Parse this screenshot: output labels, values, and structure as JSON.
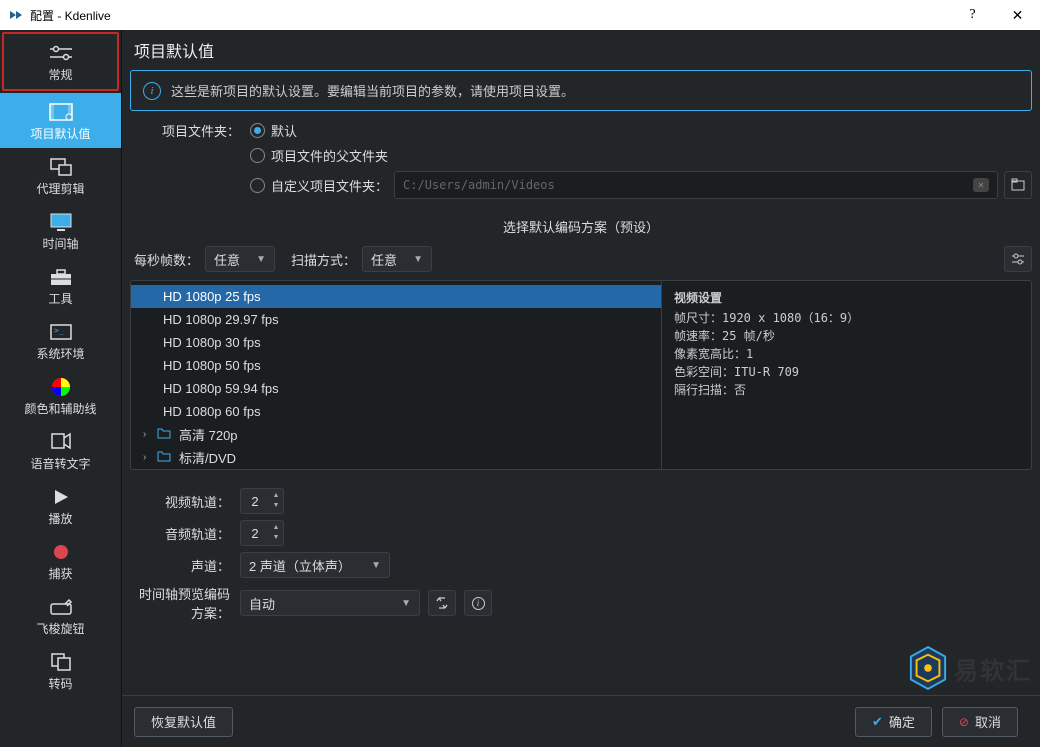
{
  "window": {
    "title": "配置 - Kdenlive"
  },
  "sidebar": {
    "items": [
      {
        "label": "常规"
      },
      {
        "label": "项目默认值"
      },
      {
        "label": "代理剪辑"
      },
      {
        "label": "时间轴"
      },
      {
        "label": "工具"
      },
      {
        "label": "系统环境"
      },
      {
        "label": "颜色和辅助线"
      },
      {
        "label": "语音转文字"
      },
      {
        "label": "播放"
      },
      {
        "label": "捕获"
      },
      {
        "label": "飞梭旋钮"
      },
      {
        "label": "转码"
      }
    ]
  },
  "page": {
    "title": "项目默认值",
    "infoText": "这些是新项目的默认设置。要编辑当前项目的参数，请使用项目设置。",
    "folderLabel": "项目文件夹：",
    "folderOptions": {
      "default": "默认",
      "parent": "项目文件的父文件夹",
      "custom": "自定义项目文件夹："
    },
    "customPath": "C:/Users/admin/Videos",
    "presetTitle": "选择默认编码方案（预设）",
    "fpsLabel": "每秒帧数：",
    "fpsValue": "任意",
    "scanLabel": "扫描方式：",
    "scanValue": "任意",
    "presets": [
      "HD 1080p 25 fps",
      "HD 1080p 29.97 fps",
      "HD 1080p 30 fps",
      "HD 1080p 50 fps",
      "HD 1080p 59.94 fps",
      "HD 1080p 60 fps"
    ],
    "presetGroups": [
      "高清 720p",
      "标清/DVD"
    ],
    "videoSettings": {
      "title": "视频设置",
      "line1": "帧尺寸：1920 x 1080（16：9）",
      "line2": "帧速率：25 帧/秒",
      "line3": "像素宽高比：1",
      "line4": "色彩空间：ITU-R 709",
      "line5": "隔行扫描：否"
    },
    "videoTracksLabel": "视频轨道：",
    "videoTracksValue": "2",
    "audioTracksLabel": "音频轨道：",
    "audioTracksValue": "2",
    "channelsLabel": "声道：",
    "channelsValue": "2 声道（立体声）",
    "previewLabel": "时间轴预览编码方案：",
    "previewValue": "自动"
  },
  "footer": {
    "restore": "恢复默认值",
    "ok": "确定",
    "cancel": "取消"
  },
  "watermark": {
    "text": "易软汇"
  }
}
